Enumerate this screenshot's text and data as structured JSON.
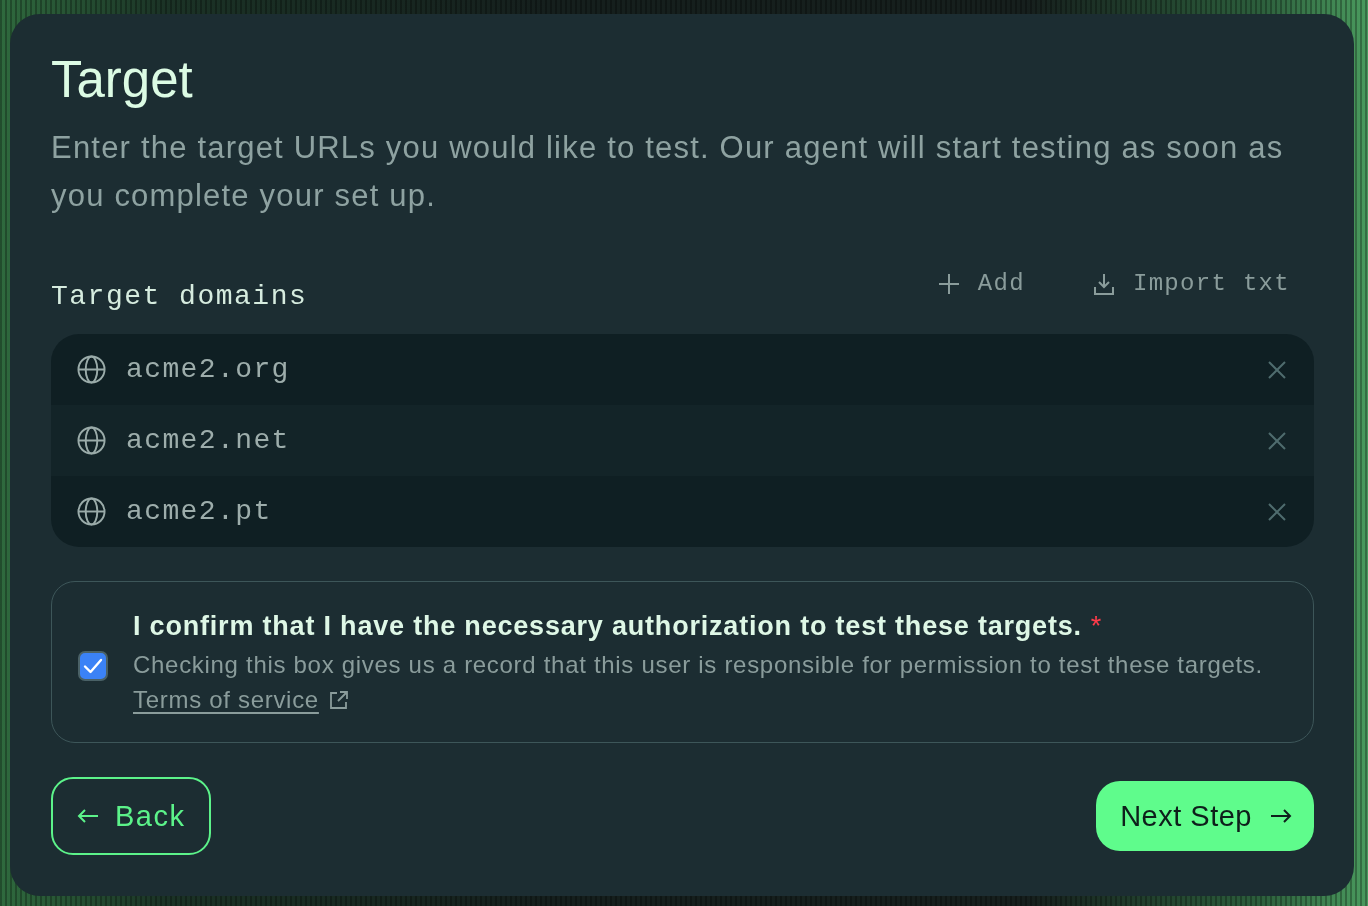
{
  "header": {
    "title": "Target",
    "description": "Enter the target URLs you would like to test. Our agent will start testing as soon as you complete your set up."
  },
  "domains": {
    "label": "Target domains",
    "actions": [
      {
        "kind": "add",
        "label": "Add"
      },
      {
        "kind": "import",
        "label": "Import txt"
      }
    ],
    "items": [
      {
        "value": "acme2.org"
      },
      {
        "value": "acme2.net"
      },
      {
        "value": "acme2.pt"
      }
    ]
  },
  "confirmation": {
    "checked": true,
    "title": "I confirm that I have the necessary authorization to test these targets.",
    "required_mark": "*",
    "description": "Checking this box gives us a record that this user is responsible for permission to test these targets.",
    "link": "Terms of service"
  },
  "buttons": [
    {
      "kind": "back",
      "label": "Back"
    },
    {
      "kind": "next",
      "label": "Next Step"
    }
  ]
}
